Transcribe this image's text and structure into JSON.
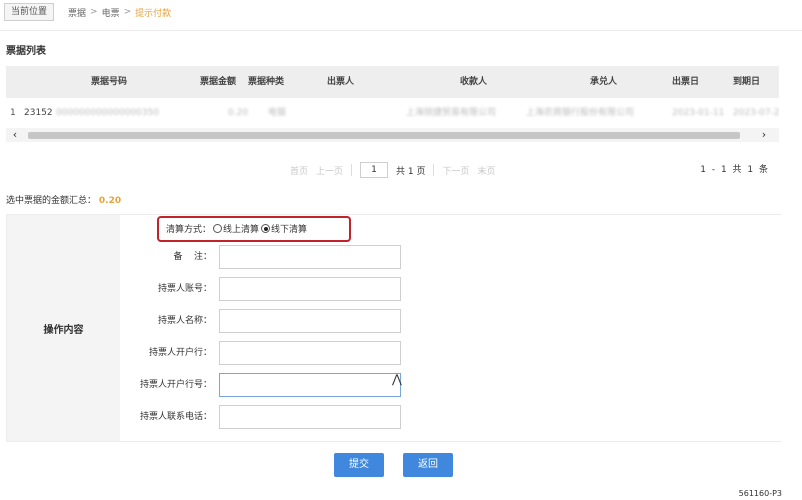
{
  "breadcrumb": {
    "current_label": "当前位置",
    "items": [
      "票据",
      "电票",
      "提示付款"
    ],
    "separator": ">"
  },
  "bill_list": {
    "title": "票据列表",
    "columns": [
      "票据号码",
      "票据金额",
      "票据种类",
      "出票人",
      "收款人",
      "承兑人",
      "出票日",
      "到期日"
    ],
    "row": {
      "index": "1",
      "bill_no_prefix": "23152",
      "bill_no_rest": "000000000000000350",
      "amount": "0.20",
      "type": "电银",
      "drawer": "",
      "payee": "上海锐捷贸易有限公司",
      "acceptor": "上海农商银行股份有限公司",
      "issue_date": "2023-01-11",
      "due_date": "2023-07-2"
    }
  },
  "pagination": {
    "first": "首页",
    "prev": "上一页",
    "page_value": "1",
    "total_pages_label": "共 1 页",
    "next": "下一页",
    "last": "末页",
    "range": "1 - 1",
    "total_count_label": "共 1 条"
  },
  "summary": {
    "label": "选中票据的金额汇总：",
    "value": "0.20"
  },
  "operation": {
    "section_label": "操作内容",
    "settlement": {
      "label": "清算方式：",
      "online": "线上清算",
      "offline": "线下清算",
      "selected": "offline"
    },
    "fields": [
      {
        "label": "备    注：",
        "value": ""
      },
      {
        "label": "持票人账号：",
        "value": ""
      },
      {
        "label": "持票人名称：",
        "value": ""
      },
      {
        "label": "持票人开户行：",
        "value": ""
      },
      {
        "label": "持票人开户行号：",
        "value": ""
      },
      {
        "label": "持票人联系电话：",
        "value": ""
      }
    ]
  },
  "buttons": {
    "submit": "提交",
    "back": "返回"
  },
  "footer": {
    "code": "561160-P3"
  },
  "colors": {
    "accent_blue": "#3f88de",
    "highlight_red": "#c0242a",
    "amount_orange": "#e8a33a"
  }
}
